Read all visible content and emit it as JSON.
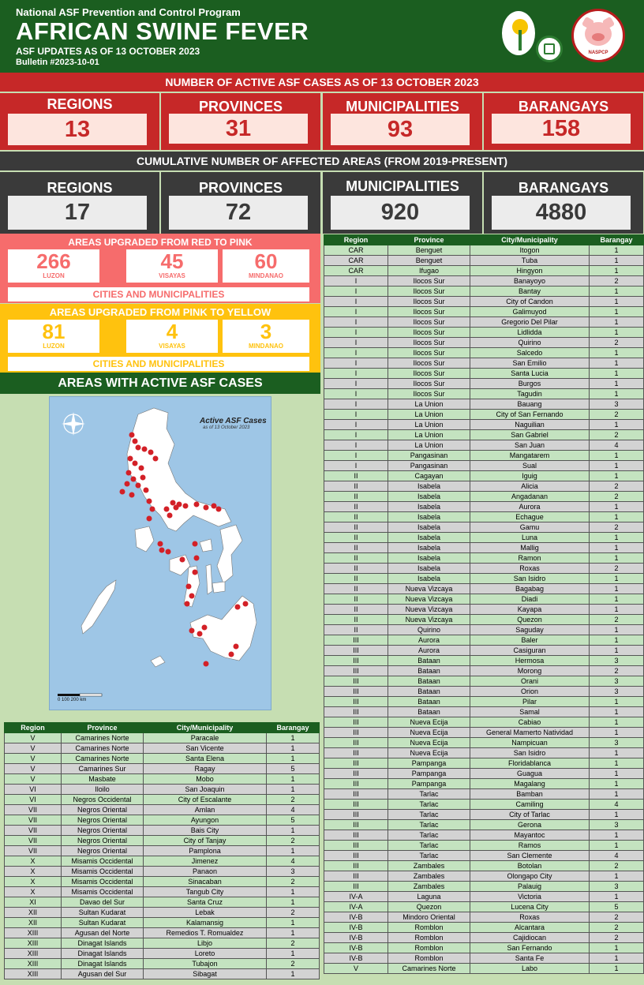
{
  "header": {
    "program": "National ASF Prevention and Control Program",
    "title": "AFRICAN SWINE FEVER",
    "updates": "ASF UPDATES AS OF 13 OCTOBER 2023",
    "bulletin": "Bulletin #2023-10-01",
    "logo_pig_text": "NASPCP"
  },
  "active": {
    "title": "NUMBER OF ACTIVE ASF CASES AS OF 13 OCTOBER 2023",
    "cards": [
      {
        "label": "REGIONS",
        "value": "13"
      },
      {
        "label": "PROVINCES",
        "value": "31"
      },
      {
        "label": "MUNICIPALITIES",
        "value": "93"
      },
      {
        "label": "BARANGAYS",
        "value": "158"
      }
    ]
  },
  "cumulative": {
    "title": "CUMULATIVE NUMBER OF AFFECTED AREAS (FROM 2019-PRESENT)",
    "cards": [
      {
        "label": "REGIONS",
        "value": "17"
      },
      {
        "label": "PROVINCES",
        "value": "72"
      },
      {
        "label": "MUNICIPALITIES",
        "value": "920"
      },
      {
        "label": "BARANGAYS",
        "value": "4880"
      }
    ]
  },
  "pink": {
    "title": "AREAS UPGRADED FROM RED TO PINK",
    "cells": [
      {
        "num": "266",
        "region": "LUZON"
      },
      {
        "num": "45",
        "region": "VISAYAS"
      },
      {
        "num": "60",
        "region": "MINDANAO"
      }
    ],
    "footer": "CITIES AND MUNICIPALITIES"
  },
  "yellow": {
    "title": "AREAS UPGRADED FROM PINK TO YELLOW",
    "cells": [
      {
        "num": "81",
        "region": "LUZON"
      },
      {
        "num": "4",
        "region": "VISAYAS"
      },
      {
        "num": "3",
        "region": "MINDANAO"
      }
    ],
    "footer": "CITIES AND MUNICIPALITIES"
  },
  "areas_title": "AREAS WITH ACTIVE ASF CASES",
  "map": {
    "title": "Active ASF Cases",
    "subtitle": "as of 13 October 2023",
    "scale": "0      100      200 km"
  },
  "table_headers": [
    "Region",
    "Province",
    "City/Municipality",
    "Barangay"
  ],
  "table_right": [
    [
      "CAR",
      "Benguet",
      "Itogon",
      "1"
    ],
    [
      "CAR",
      "Benguet",
      "Tuba",
      "1"
    ],
    [
      "CAR",
      "Ifugao",
      "Hingyon",
      "1"
    ],
    [
      "I",
      "Ilocos Sur",
      "Banayoyo",
      "2"
    ],
    [
      "I",
      "Ilocos Sur",
      "Bantay",
      "1"
    ],
    [
      "I",
      "Ilocos Sur",
      "City of Candon",
      "1"
    ],
    [
      "I",
      "Ilocos Sur",
      "Galimuyod",
      "1"
    ],
    [
      "I",
      "Ilocos Sur",
      "Gregorio Del Pilar",
      "1"
    ],
    [
      "I",
      "Ilocos Sur",
      "Lidlidda",
      "1"
    ],
    [
      "I",
      "Ilocos Sur",
      "Quirino",
      "2"
    ],
    [
      "I",
      "Ilocos Sur",
      "Salcedo",
      "1"
    ],
    [
      "I",
      "Ilocos Sur",
      "San Emilio",
      "1"
    ],
    [
      "I",
      "Ilocos Sur",
      "Santa Lucia",
      "1"
    ],
    [
      "I",
      "Ilocos Sur",
      "Burgos",
      "1"
    ],
    [
      "I",
      "Ilocos Sur",
      "Tagudin",
      "1"
    ],
    [
      "I",
      "La Union",
      "Bauang",
      "3"
    ],
    [
      "I",
      "La Union",
      "City of San Fernando",
      "2"
    ],
    [
      "I",
      "La Union",
      "Naguilian",
      "1"
    ],
    [
      "I",
      "La Union",
      "San Gabriel",
      "2"
    ],
    [
      "I",
      "La Union",
      "San Juan",
      "4"
    ],
    [
      "I",
      "Pangasinan",
      "Mangatarem",
      "1"
    ],
    [
      "I",
      "Pangasinan",
      "Sual",
      "1"
    ],
    [
      "II",
      "Cagayan",
      "Iguig",
      "1"
    ],
    [
      "II",
      "Isabela",
      "Alicia",
      "2"
    ],
    [
      "II",
      "Isabela",
      "Angadanan",
      "2"
    ],
    [
      "II",
      "Isabela",
      "Aurora",
      "1"
    ],
    [
      "II",
      "Isabela",
      "Echague",
      "1"
    ],
    [
      "II",
      "Isabela",
      "Gamu",
      "2"
    ],
    [
      "II",
      "Isabela",
      "Luna",
      "1"
    ],
    [
      "II",
      "Isabela",
      "Mallig",
      "1"
    ],
    [
      "II",
      "Isabela",
      "Ramon",
      "1"
    ],
    [
      "II",
      "Isabela",
      "Roxas",
      "2"
    ],
    [
      "II",
      "Isabela",
      "San Isidro",
      "1"
    ],
    [
      "II",
      "Nueva Vizcaya",
      "Bagabag",
      "1"
    ],
    [
      "II",
      "Nueva Vizcaya",
      "Diadi",
      "1"
    ],
    [
      "II",
      "Nueva Vizcaya",
      "Kayapa",
      "1"
    ],
    [
      "II",
      "Nueva Vizcaya",
      "Quezon",
      "2"
    ],
    [
      "II",
      "Quirino",
      "Saguday",
      "1"
    ],
    [
      "III",
      "Aurora",
      "Baler",
      "1"
    ],
    [
      "III",
      "Aurora",
      "Casiguran",
      "1"
    ],
    [
      "III",
      "Bataan",
      "Hermosa",
      "3"
    ],
    [
      "III",
      "Bataan",
      "Morong",
      "2"
    ],
    [
      "III",
      "Bataan",
      "Orani",
      "3"
    ],
    [
      "III",
      "Bataan",
      "Orion",
      "3"
    ],
    [
      "III",
      "Bataan",
      "Pilar",
      "1"
    ],
    [
      "III",
      "Bataan",
      "Samal",
      "1"
    ],
    [
      "III",
      "Nueva Ecija",
      "Cabiao",
      "1"
    ],
    [
      "III",
      "Nueva Ecija",
      "General Mamerto Natividad",
      "1"
    ],
    [
      "III",
      "Nueva Ecija",
      "Nampicuan",
      "3"
    ],
    [
      "III",
      "Nueva Ecija",
      "San Isidro",
      "1"
    ],
    [
      "III",
      "Pampanga",
      "Floridablanca",
      "1"
    ],
    [
      "III",
      "Pampanga",
      "Guagua",
      "1"
    ],
    [
      "III",
      "Pampanga",
      "Magalang",
      "1"
    ],
    [
      "III",
      "Tarlac",
      "Bamban",
      "1"
    ],
    [
      "III",
      "Tarlac",
      "Camiling",
      "4"
    ],
    [
      "III",
      "Tarlac",
      "City of Tarlac",
      "1"
    ],
    [
      "III",
      "Tarlac",
      "Gerona",
      "3"
    ],
    [
      "III",
      "Tarlac",
      "Mayantoc",
      "1"
    ],
    [
      "III",
      "Tarlac",
      "Ramos",
      "1"
    ],
    [
      "III",
      "Tarlac",
      "San Clemente",
      "4"
    ],
    [
      "III",
      "Zambales",
      "Botolan",
      "2"
    ],
    [
      "III",
      "Zambales",
      "Olongapo City",
      "1"
    ],
    [
      "III",
      "Zambales",
      "Palauig",
      "3"
    ],
    [
      "IV-A",
      "Laguna",
      "Victoria",
      "1"
    ],
    [
      "IV-A",
      "Quezon",
      "Lucena City",
      "5"
    ],
    [
      "IV-B",
      "Mindoro Oriental",
      "Roxas",
      "2"
    ],
    [
      "IV-B",
      "Romblon",
      "Alcantara",
      "2"
    ],
    [
      "IV-B",
      "Romblon",
      "Cajidiocan",
      "2"
    ],
    [
      "IV-B",
      "Romblon",
      "San Fernando",
      "1"
    ],
    [
      "IV-B",
      "Romblon",
      "Santa Fe",
      "1"
    ],
    [
      "V",
      "Camarines Norte",
      "Labo",
      "1"
    ]
  ],
  "table_left": [
    [
      "V",
      "Camarines Norte",
      "Paracale",
      "1"
    ],
    [
      "V",
      "Camarines Norte",
      "San Vicente",
      "1"
    ],
    [
      "V",
      "Camarines Norte",
      "Santa Elena",
      "1"
    ],
    [
      "V",
      "Camarines Sur",
      "Ragay",
      "5"
    ],
    [
      "V",
      "Masbate",
      "Mobo",
      "1"
    ],
    [
      "VI",
      "Iloilo",
      "San Joaquin",
      "1"
    ],
    [
      "VI",
      "Negros Occidental",
      "City of Escalante",
      "2"
    ],
    [
      "VII",
      "Negros Oriental",
      "Amlan",
      "4"
    ],
    [
      "VII",
      "Negros Oriental",
      "Ayungon",
      "5"
    ],
    [
      "VII",
      "Negros Oriental",
      "Bais City",
      "1"
    ],
    [
      "VII",
      "Negros Oriental",
      "City of Tanjay",
      "2"
    ],
    [
      "VII",
      "Negros Oriental",
      "Pamplona",
      "1"
    ],
    [
      "X",
      "Misamis Occidental",
      "Jimenez",
      "4"
    ],
    [
      "X",
      "Misamis Occidental",
      "Panaon",
      "3"
    ],
    [
      "X",
      "Misamis Occidental",
      "Sinacaban",
      "2"
    ],
    [
      "X",
      "Misamis Occidental",
      "Tangub City",
      "1"
    ],
    [
      "XI",
      "Davao del Sur",
      "Santa Cruz",
      "1"
    ],
    [
      "XII",
      "Sultan Kudarat",
      "Lebak",
      "2"
    ],
    [
      "XII",
      "Sultan Kudarat",
      "Kalamansig",
      "1"
    ],
    [
      "XIII",
      "Agusan del Norte",
      "Remedios T. Romualdez",
      "1"
    ],
    [
      "XIII",
      "Dinagat Islands",
      "Libjo",
      "2"
    ],
    [
      "XIII",
      "Dinagat Islands",
      "Loreto",
      "1"
    ],
    [
      "XIII",
      "Dinagat Islands",
      "Tubajon",
      "2"
    ],
    [
      "XIII",
      "Agusan del Sur",
      "Sibagat",
      "1"
    ]
  ],
  "colors": {
    "green": "#1b5e20",
    "red": "#c62828",
    "dark": "#3a3a3a",
    "pink": "#f66c6c",
    "yellow": "#ffc20e",
    "bg": "#c6deb2"
  }
}
